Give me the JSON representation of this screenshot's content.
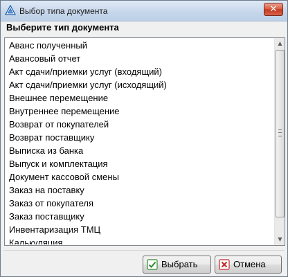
{
  "window": {
    "title": "Выбор типа документа",
    "close_glyph": "✕",
    "app_icon": "app-icon"
  },
  "prompt": "Выберите тип документа",
  "document_types": [
    "Аванс полученный",
    "Авансовый отчет",
    "Акт сдачи/приемки услуг (входящий)",
    "Акт сдачи/приемки услуг (исходящий)",
    "Внешнее перемещение",
    "Внутреннее перемещение",
    "Возврат от покупателей",
    "Возврат поставщику",
    "Выписка из банка",
    "Выпуск и комплектация",
    "Документ кассовой смены",
    "Заказ на поставку",
    "Заказ от покупателя",
    "Заказ поставщику",
    "Инвентаризация ТМЦ",
    "Калькуляция"
  ],
  "scrollbar": {
    "up_glyph": "▲",
    "down_glyph": "▼",
    "thumb_fraction_visible": 0.84
  },
  "buttons": {
    "select_label": "Выбрать",
    "select_icon": "confirm-icon",
    "cancel_label": "Отмена",
    "cancel_icon": "cancel-icon"
  },
  "colors": {
    "confirm_green": "#2e8b2e",
    "cancel_red": "#c62828",
    "title_gradient": "#c6d6ea"
  }
}
